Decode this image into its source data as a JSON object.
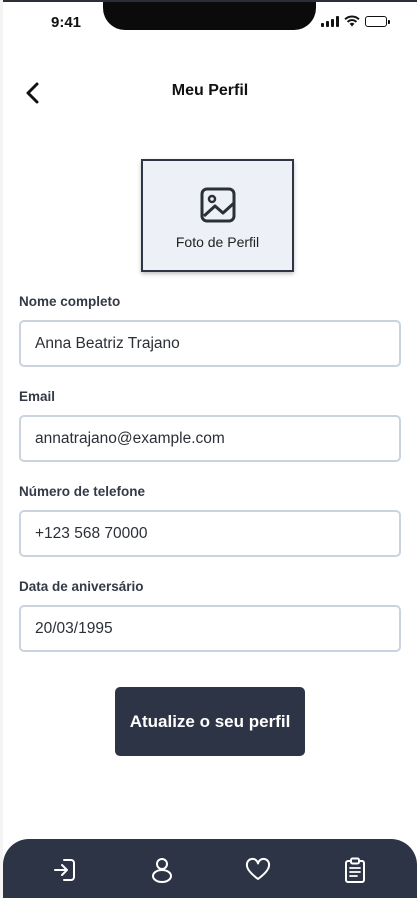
{
  "status_bar": {
    "time": "9:41"
  },
  "header": {
    "title": "Meu Perfil",
    "back_icon": "chevron-left-icon"
  },
  "profile_photo": {
    "label": "Foto de Perfil",
    "icon": "image-icon"
  },
  "form": {
    "full_name": {
      "label": "Nome completo",
      "value": "Anna Beatriz Trajano"
    },
    "email": {
      "label": "Email",
      "value": "annatrajano@example.com"
    },
    "phone": {
      "label": "Número de telefone",
      "value": "+123 568 70000"
    },
    "birthday": {
      "label": "Data de aniversário",
      "value": "20/03/1995"
    }
  },
  "submit": {
    "label": "Atualize o seu perfil"
  },
  "tab_bar": {
    "items": [
      {
        "icon": "login-icon"
      },
      {
        "icon": "user-icon"
      },
      {
        "icon": "heart-icon"
      },
      {
        "icon": "clipboard-icon"
      }
    ]
  },
  "colors": {
    "primary": "#2d3446",
    "input_border": "#cbd3de",
    "photo_bg": "#eef0f8"
  }
}
